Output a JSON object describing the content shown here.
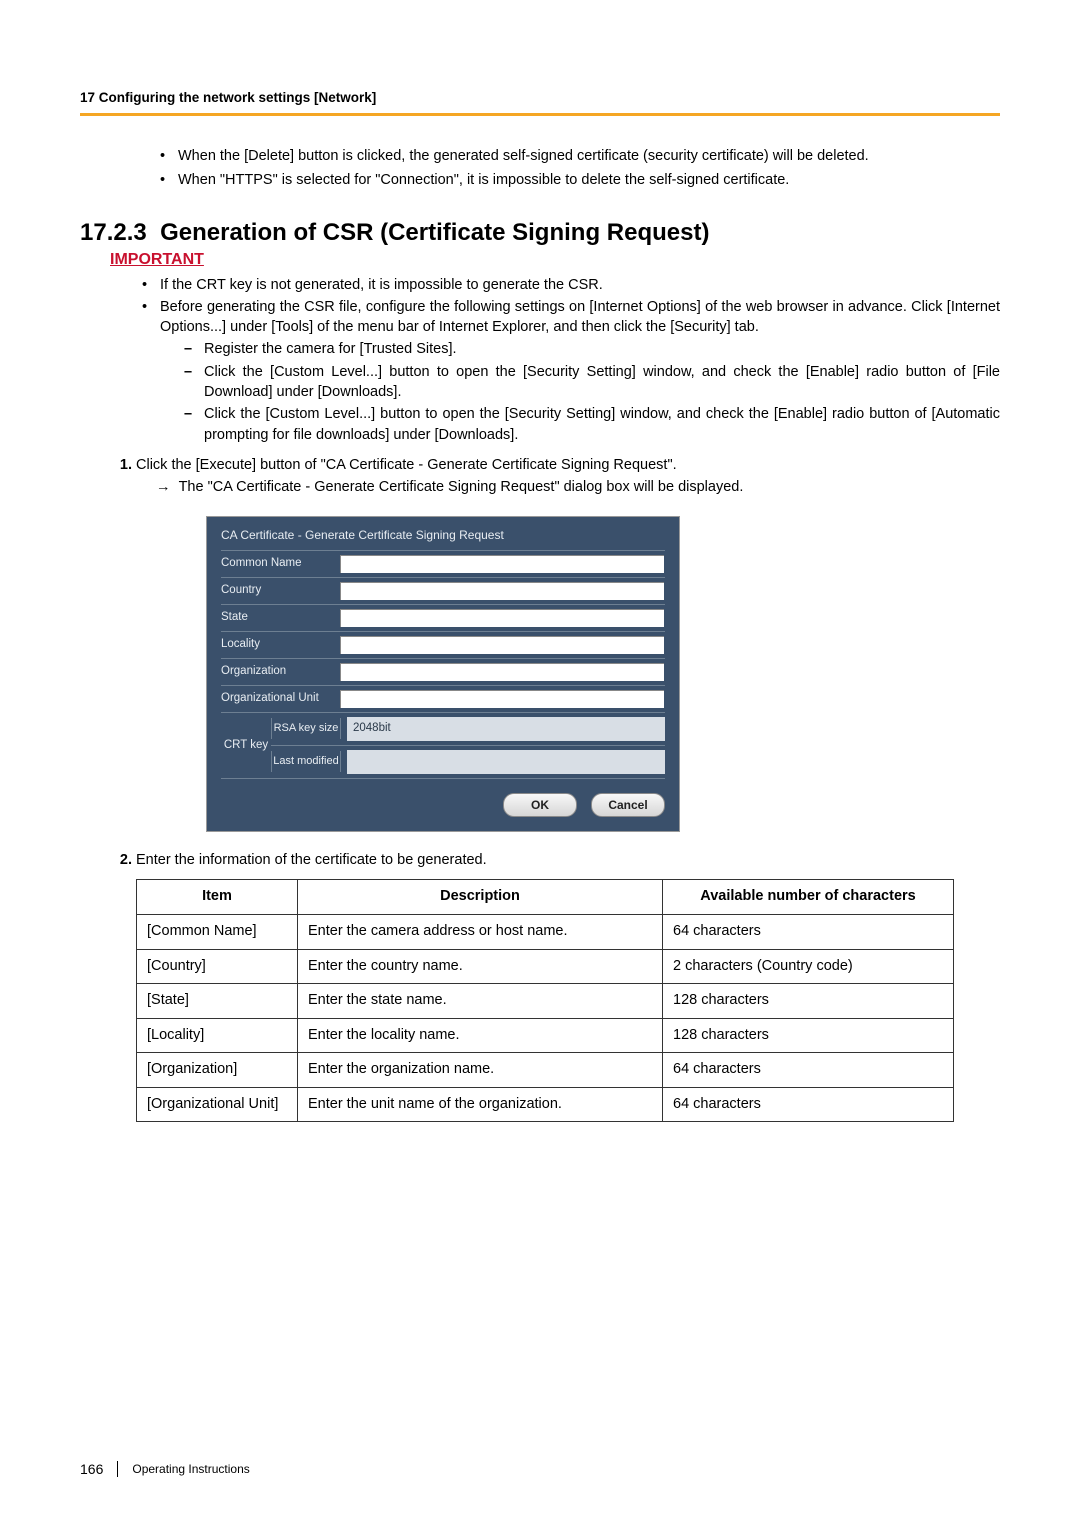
{
  "header": {
    "chapter": "17 Configuring the network settings [Network]"
  },
  "intro_bullets": [
    "When the [Delete] button is clicked, the generated self-signed certificate (security certificate) will be deleted.",
    "When \"HTTPS\" is selected for \"Connection\", it is impossible to delete the self-signed certificate."
  ],
  "section": {
    "number": "17.2.3",
    "title": "Generation of CSR (Certificate Signing Request)"
  },
  "important_label": "IMPORTANT",
  "important_bullets": [
    "If the CRT key is not generated, it is impossible to generate the CSR.",
    "Before generating the CSR file, configure the following settings on [Internet Options] of the web browser in advance. Click [Internet Options...] under [Tools] of the menu bar of Internet Explorer, and then click the [Security] tab."
  ],
  "important_dashes": [
    "Register the camera for [Trusted Sites].",
    "Click the [Custom Level...] button to open the [Security Setting] window, and check the [Enable] radio button of [File Download] under [Downloads].",
    "Click the [Custom Level...] button to open the [Security Setting] window, and check the [Enable] radio button of [Automatic prompting for file downloads] under [Downloads]."
  ],
  "steps": {
    "s1": "Click the [Execute] button of \"CA Certificate - Generate Certificate Signing Request\".",
    "s1_arrow": "The \"CA Certificate - Generate Certificate Signing Request\" dialog box will be displayed.",
    "s2": "Enter the information of the certificate to be generated."
  },
  "dialog": {
    "title": "CA Certificate - Generate Certificate Signing Request",
    "labels": {
      "common_name": "Common Name",
      "country": "Country",
      "state": "State",
      "locality": "Locality",
      "organization": "Organization",
      "org_unit": "Organizational Unit",
      "crt_key": "CRT key",
      "rsa": "RSA key size",
      "last_mod": "Last modified"
    },
    "rsa_value": "2048bit",
    "last_mod_value": "",
    "ok": "OK",
    "cancel": "Cancel"
  },
  "table": {
    "headers": {
      "item": "Item",
      "desc": "Description",
      "avail": "Available number of characters"
    },
    "rows": [
      {
        "item": "[Common Name]",
        "desc": "Enter the camera address or host name.",
        "avail": "64 characters"
      },
      {
        "item": "[Country]",
        "desc": "Enter the country name.",
        "avail": "2 characters (Country code)"
      },
      {
        "item": "[State]",
        "desc": "Enter the state name.",
        "avail": "128 characters"
      },
      {
        "item": "[Locality]",
        "desc": "Enter the locality name.",
        "avail": "128 characters"
      },
      {
        "item": "[Organization]",
        "desc": "Enter the organization name.",
        "avail": "64 characters"
      },
      {
        "item": "[Organizational Unit]",
        "desc": "Enter the unit name of the organization.",
        "avail": "64 characters"
      }
    ]
  },
  "footer": {
    "page": "166",
    "doc": "Operating Instructions"
  }
}
